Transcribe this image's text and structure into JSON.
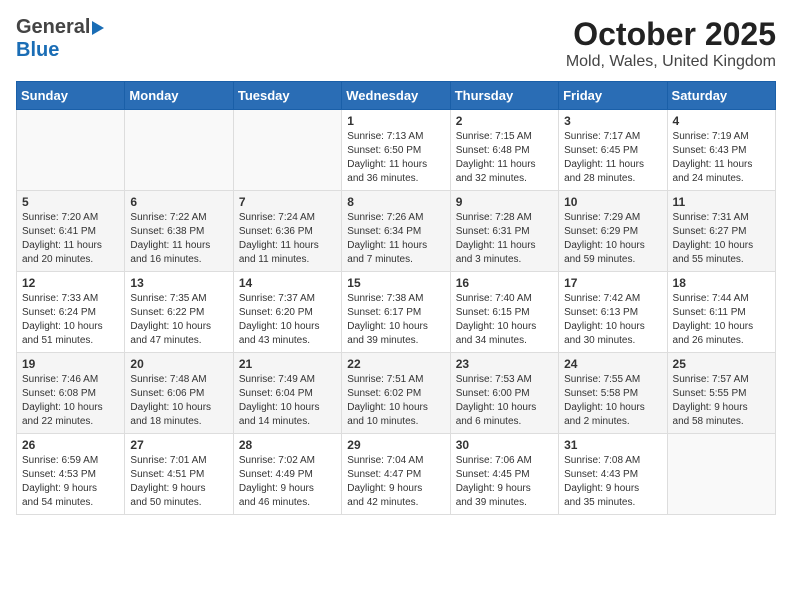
{
  "header": {
    "logo_general": "General",
    "logo_blue": "Blue",
    "month": "October 2025",
    "location": "Mold, Wales, United Kingdom"
  },
  "days_of_week": [
    "Sunday",
    "Monday",
    "Tuesday",
    "Wednesday",
    "Thursday",
    "Friday",
    "Saturday"
  ],
  "weeks": [
    [
      {
        "day": "",
        "info": ""
      },
      {
        "day": "",
        "info": ""
      },
      {
        "day": "",
        "info": ""
      },
      {
        "day": "1",
        "info": "Sunrise: 7:13 AM\nSunset: 6:50 PM\nDaylight: 11 hours\nand 36 minutes."
      },
      {
        "day": "2",
        "info": "Sunrise: 7:15 AM\nSunset: 6:48 PM\nDaylight: 11 hours\nand 32 minutes."
      },
      {
        "day": "3",
        "info": "Sunrise: 7:17 AM\nSunset: 6:45 PM\nDaylight: 11 hours\nand 28 minutes."
      },
      {
        "day": "4",
        "info": "Sunrise: 7:19 AM\nSunset: 6:43 PM\nDaylight: 11 hours\nand 24 minutes."
      }
    ],
    [
      {
        "day": "5",
        "info": "Sunrise: 7:20 AM\nSunset: 6:41 PM\nDaylight: 11 hours\nand 20 minutes."
      },
      {
        "day": "6",
        "info": "Sunrise: 7:22 AM\nSunset: 6:38 PM\nDaylight: 11 hours\nand 16 minutes."
      },
      {
        "day": "7",
        "info": "Sunrise: 7:24 AM\nSunset: 6:36 PM\nDaylight: 11 hours\nand 11 minutes."
      },
      {
        "day": "8",
        "info": "Sunrise: 7:26 AM\nSunset: 6:34 PM\nDaylight: 11 hours\nand 7 minutes."
      },
      {
        "day": "9",
        "info": "Sunrise: 7:28 AM\nSunset: 6:31 PM\nDaylight: 11 hours\nand 3 minutes."
      },
      {
        "day": "10",
        "info": "Sunrise: 7:29 AM\nSunset: 6:29 PM\nDaylight: 10 hours\nand 59 minutes."
      },
      {
        "day": "11",
        "info": "Sunrise: 7:31 AM\nSunset: 6:27 PM\nDaylight: 10 hours\nand 55 minutes."
      }
    ],
    [
      {
        "day": "12",
        "info": "Sunrise: 7:33 AM\nSunset: 6:24 PM\nDaylight: 10 hours\nand 51 minutes."
      },
      {
        "day": "13",
        "info": "Sunrise: 7:35 AM\nSunset: 6:22 PM\nDaylight: 10 hours\nand 47 minutes."
      },
      {
        "day": "14",
        "info": "Sunrise: 7:37 AM\nSunset: 6:20 PM\nDaylight: 10 hours\nand 43 minutes."
      },
      {
        "day": "15",
        "info": "Sunrise: 7:38 AM\nSunset: 6:17 PM\nDaylight: 10 hours\nand 39 minutes."
      },
      {
        "day": "16",
        "info": "Sunrise: 7:40 AM\nSunset: 6:15 PM\nDaylight: 10 hours\nand 34 minutes."
      },
      {
        "day": "17",
        "info": "Sunrise: 7:42 AM\nSunset: 6:13 PM\nDaylight: 10 hours\nand 30 minutes."
      },
      {
        "day": "18",
        "info": "Sunrise: 7:44 AM\nSunset: 6:11 PM\nDaylight: 10 hours\nand 26 minutes."
      }
    ],
    [
      {
        "day": "19",
        "info": "Sunrise: 7:46 AM\nSunset: 6:08 PM\nDaylight: 10 hours\nand 22 minutes."
      },
      {
        "day": "20",
        "info": "Sunrise: 7:48 AM\nSunset: 6:06 PM\nDaylight: 10 hours\nand 18 minutes."
      },
      {
        "day": "21",
        "info": "Sunrise: 7:49 AM\nSunset: 6:04 PM\nDaylight: 10 hours\nand 14 minutes."
      },
      {
        "day": "22",
        "info": "Sunrise: 7:51 AM\nSunset: 6:02 PM\nDaylight: 10 hours\nand 10 minutes."
      },
      {
        "day": "23",
        "info": "Sunrise: 7:53 AM\nSunset: 6:00 PM\nDaylight: 10 hours\nand 6 minutes."
      },
      {
        "day": "24",
        "info": "Sunrise: 7:55 AM\nSunset: 5:58 PM\nDaylight: 10 hours\nand 2 minutes."
      },
      {
        "day": "25",
        "info": "Sunrise: 7:57 AM\nSunset: 5:55 PM\nDaylight: 9 hours\nand 58 minutes."
      }
    ],
    [
      {
        "day": "26",
        "info": "Sunrise: 6:59 AM\nSunset: 4:53 PM\nDaylight: 9 hours\nand 54 minutes."
      },
      {
        "day": "27",
        "info": "Sunrise: 7:01 AM\nSunset: 4:51 PM\nDaylight: 9 hours\nand 50 minutes."
      },
      {
        "day": "28",
        "info": "Sunrise: 7:02 AM\nSunset: 4:49 PM\nDaylight: 9 hours\nand 46 minutes."
      },
      {
        "day": "29",
        "info": "Sunrise: 7:04 AM\nSunset: 4:47 PM\nDaylight: 9 hours\nand 42 minutes."
      },
      {
        "day": "30",
        "info": "Sunrise: 7:06 AM\nSunset: 4:45 PM\nDaylight: 9 hours\nand 39 minutes."
      },
      {
        "day": "31",
        "info": "Sunrise: 7:08 AM\nSunset: 4:43 PM\nDaylight: 9 hours\nand 35 minutes."
      },
      {
        "day": "",
        "info": ""
      }
    ]
  ]
}
